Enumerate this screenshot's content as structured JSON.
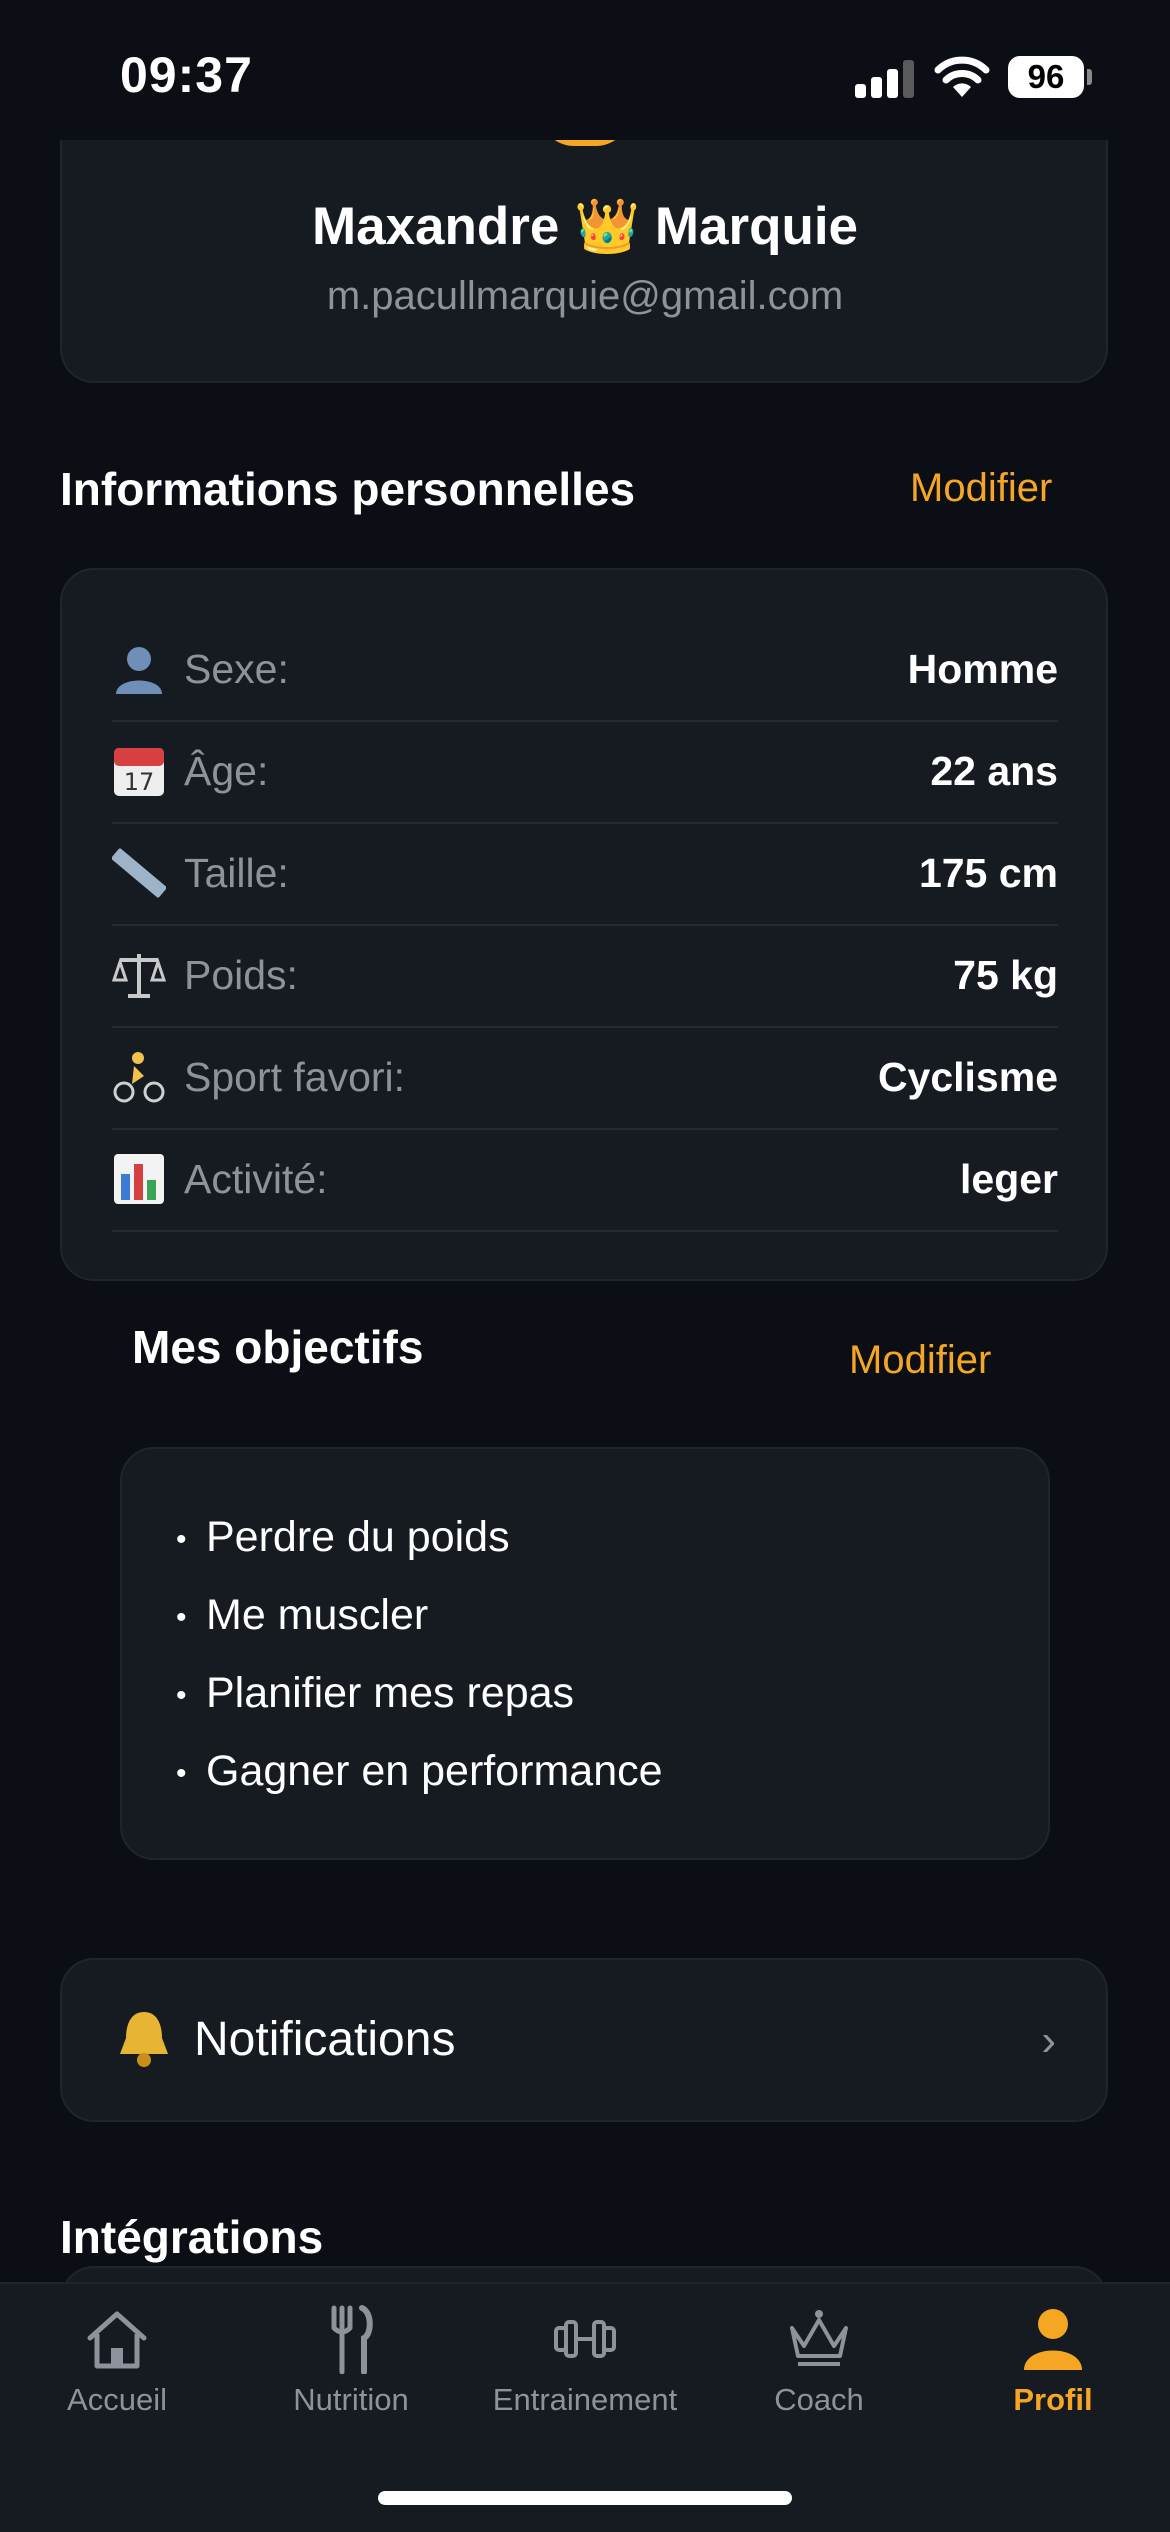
{
  "status_bar": {
    "time": "09:37",
    "battery": "96"
  },
  "profile": {
    "name": "Maxandre 👑 Marquie",
    "email": "m.pacullmarquie@gmail.com"
  },
  "personal_info": {
    "title": "Informations personnelles",
    "edit_label": "Modifier",
    "rows": [
      {
        "icon": "person-icon",
        "label": "Sexe:",
        "value": "Homme"
      },
      {
        "icon": "calendar-icon",
        "label": "Âge:",
        "value": "22 ans"
      },
      {
        "icon": "ruler-icon",
        "label": "Taille:",
        "value": "175 cm"
      },
      {
        "icon": "scale-icon",
        "label": "Poids:",
        "value": "75 kg"
      },
      {
        "icon": "cyclist-icon",
        "label": "Sport favori:",
        "value": "Cyclisme"
      },
      {
        "icon": "bar-chart-icon",
        "label": "Activité:",
        "value": "leger"
      }
    ]
  },
  "goals": {
    "title": "Mes objectifs",
    "edit_label": "Modifier",
    "items": [
      "Perdre du poids",
      "Me muscler",
      "Planifier mes repas",
      "Gagner en performance"
    ]
  },
  "notifications": {
    "icon": "bell-icon",
    "label": "Notifications"
  },
  "integrations": {
    "title": "Intégrations"
  },
  "tab_bar": {
    "active": "Profil",
    "accent_color": "#f5a623",
    "tabs": [
      {
        "icon": "home-icon",
        "label": "Accueil"
      },
      {
        "icon": "fork-knife-icon",
        "label": "Nutrition"
      },
      {
        "icon": "dumbbell-icon",
        "label": "Entrainement"
      },
      {
        "icon": "crown-icon",
        "label": "Coach"
      },
      {
        "icon": "person-icon",
        "label": "Profil"
      }
    ]
  }
}
